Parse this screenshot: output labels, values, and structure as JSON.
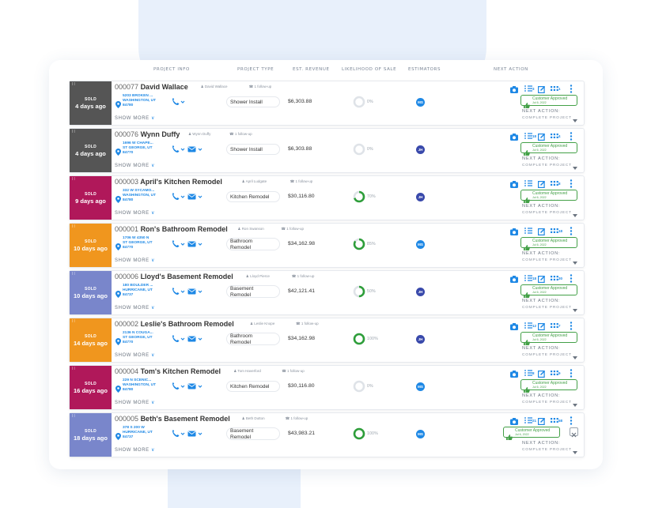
{
  "headers": {
    "project_info": "PROJECT INFO",
    "project_type": "PROJECT TYPE",
    "est_revenue": "EST. REVENUE",
    "likelihood": "LIKELIHOOD OF SALE",
    "estimators": "ESTIMATORS",
    "next_action": "NEXT ACTION"
  },
  "common": {
    "sold": "SOLD",
    "show_more": "SHOW MORE",
    "follow_up": "1 follow-up",
    "approved": "Customer Approved",
    "approved_date": "Jul 6, 2022",
    "next_action_label": "NEXT ACTION:",
    "next_action_value": "COMPLETE PROJECT"
  },
  "rows": [
    {
      "num": "000077",
      "name": "David Wallace",
      "contact": "David Wallace",
      "ago": "4 days ago",
      "status_color": "#555555",
      "addr1": "5203 BROKEN ...",
      "addr2": "WASHINGTON, UT",
      "addr3": "84780",
      "email": false,
      "type1": "Shower Install",
      "type2": "",
      "revenue": "$6,303.88",
      "pct": "0%",
      "pct_value": 0,
      "est": "MS",
      "est_color": "#1e88e5",
      "badges": [
        "3",
        "1"
      ],
      "alt_layout": false
    },
    {
      "num": "000076",
      "name": "Wynn Duffy",
      "contact": "Wynn Duffy",
      "ago": "4 days ago",
      "status_color": "#555555",
      "addr1": "1696 W CHAPE...",
      "addr2": "ST GEORGE, UT",
      "addr3": "84770",
      "email": true,
      "type1": "Shower Install",
      "type2": "",
      "revenue": "$6,303.88",
      "pct": "0%",
      "pct_value": 0,
      "est": "JH",
      "est_color": "#3949ab",
      "badges": [
        "18",
        "4"
      ],
      "alt_layout": false
    },
    {
      "num": "000003",
      "name": "April's Kitchen Remodel",
      "contact": "April Ludgate",
      "ago": "9 days ago",
      "status_color": "#b0185a",
      "addr1": "332 W SYCAMO...",
      "addr2": "WASHINGTON, UT",
      "addr3": "84780",
      "email": true,
      "type1": "Kitchen Remodel",
      "type2": "",
      "revenue": "$30,116.80",
      "pct": "70%",
      "pct_value": 70,
      "est": "JH",
      "est_color": "#3949ab",
      "badges": [
        "",
        "8"
      ],
      "alt_layout": false
    },
    {
      "num": "000001",
      "name": "Ron's Bathroom Remodel",
      "contact": "Ron Swanson",
      "ago": "10 days ago",
      "status_color": "#f0961e",
      "addr1": "1706 W 4350 N",
      "addr2": "ST GEORGE, UT",
      "addr3": "84770",
      "email": true,
      "type1": "Bathroom",
      "type2": "Remodel",
      "revenue": "$34,162.98",
      "pct": "85%",
      "pct_value": 85,
      "est": "MS",
      "est_color": "#1e88e5",
      "badges": [
        "",
        "18"
      ],
      "alt_layout": false
    },
    {
      "num": "000006",
      "name": "Lloyd's Basement Remodel",
      "contact": "Lloyd Pierce",
      "ago": "10 days ago",
      "status_color": "#7986cb",
      "addr1": "180 BOULDER ...",
      "addr2": "HURRICANE, UT",
      "addr3": "84737",
      "email": true,
      "type1": "Basement",
      "type2": "Remodel",
      "revenue": "$42,121.41",
      "pct": "50%",
      "pct_value": 50,
      "est": "JH",
      "est_color": "#3949ab",
      "badges": [
        "18",
        "30"
      ],
      "alt_layout": false
    },
    {
      "num": "000002",
      "name": "Leslie's Bathroom Remodel",
      "contact": "Leslie Knope",
      "ago": "14 days ago",
      "status_color": "#f0961e",
      "addr1": "2136 N COUGA...",
      "addr2": "ST GEORGE, UT",
      "addr3": "84770",
      "email": true,
      "type1": "Bathroom",
      "type2": "Remodel",
      "revenue": "$34,162.98",
      "pct": "100%",
      "pct_value": 100,
      "est": "JH",
      "est_color": "#3949ab",
      "badges": [
        "12",
        "7"
      ],
      "alt_layout": false
    },
    {
      "num": "000004",
      "name": "Tom's Kitchen Remodel",
      "contact": "Tom Haverford",
      "ago": "16 days ago",
      "status_color": "#b0185a",
      "addr1": "229 N SCENIC...",
      "addr2": "WASHINGTON, UT",
      "addr3": "84780",
      "email": true,
      "type1": "Kitchen Remodel",
      "type2": "",
      "revenue": "$30,116.80",
      "pct": "0%",
      "pct_value": 0,
      "est": "MS",
      "est_color": "#1e88e5",
      "badges": [
        "8",
        "9"
      ],
      "alt_layout": false
    },
    {
      "num": "000005",
      "name": "Beth's Basement Remodel",
      "contact": "Beth Dutton",
      "ago": "18 days ago",
      "status_color": "#7986cb",
      "addr1": "378 S 200 W",
      "addr2": "HURRICANE, UT",
      "addr3": "84737",
      "email": true,
      "type1": "Basement",
      "type2": "Remodel",
      "revenue": "$43,983.21",
      "pct": "100%",
      "pct_value": 100,
      "est": "MS",
      "est_color": "#1e88e5",
      "badges": [
        "21",
        "58"
      ],
      "alt_layout": true
    }
  ]
}
